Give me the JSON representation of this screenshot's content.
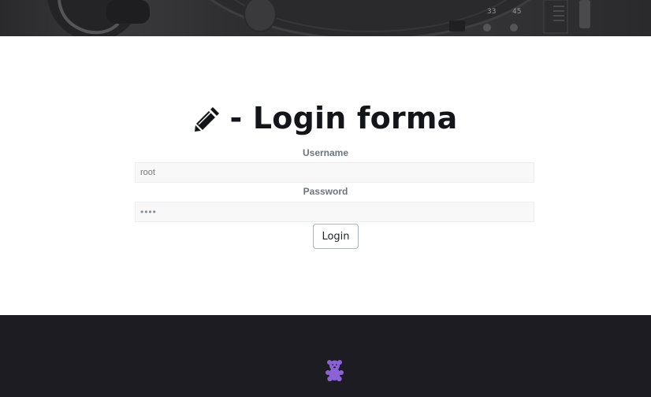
{
  "banner": {
    "dial_numbers": [
      "33",
      "45"
    ]
  },
  "login": {
    "title": "- Login forma",
    "username_label": "Username",
    "username_placeholder": "root",
    "password_label": "Password",
    "password_value": "••••",
    "button_label": "Login"
  },
  "footer": {
    "logo_icon": "teddy-bear-icon"
  },
  "colors": {
    "accent": "#8b63d6",
    "footer_bg": "#1c1c22",
    "heading": "#131519"
  }
}
